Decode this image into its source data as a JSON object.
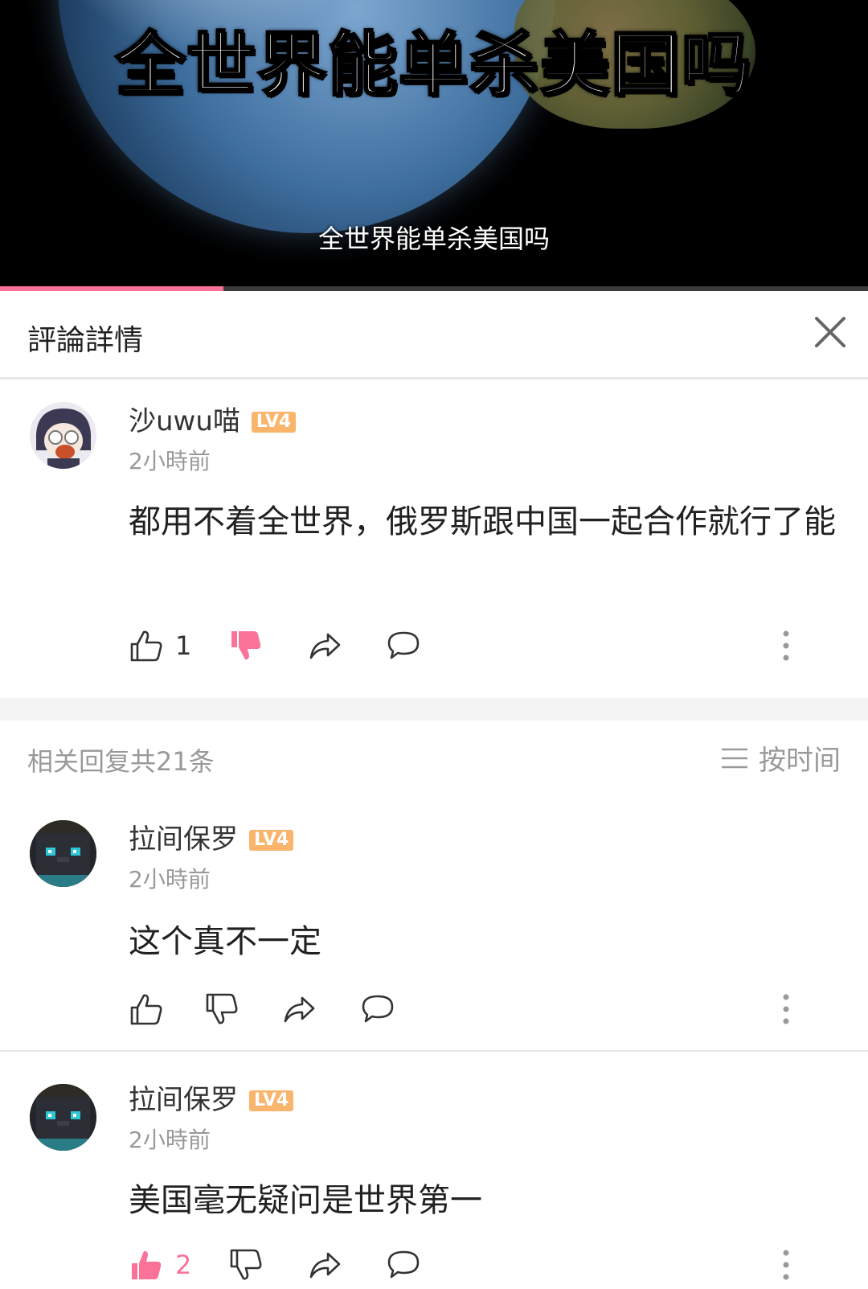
{
  "video": {
    "title_overlay": "全世界能单杀美国吗",
    "subtitle": "全世界能单杀美国吗",
    "progress": 0.257
  },
  "panel": {
    "title": "評論詳情",
    "close_icon": "close-icon"
  },
  "main_comment": {
    "username": "沙uwu喵",
    "level": "LV4",
    "time": "2小時前",
    "text": "都用不着全世界，俄罗斯跟中国一起合作就行了能",
    "likes": "1",
    "disliked": true
  },
  "replies_header": {
    "count_text": "相关回复共21条",
    "sort_label": "按时间"
  },
  "replies": [
    {
      "username": "拉间保罗",
      "level": "LV4",
      "time": "2小時前",
      "text": "这个真不一定",
      "likes": "",
      "liked": false
    },
    {
      "username": "拉间保罗",
      "level": "LV4",
      "time": "2小時前",
      "text": "美国毫无疑问是世界第一",
      "likes": "2",
      "liked": true
    }
  ],
  "colors": {
    "accent": "#fb7299",
    "level_badge": "#f9b56c",
    "muted_text": "#999999"
  }
}
